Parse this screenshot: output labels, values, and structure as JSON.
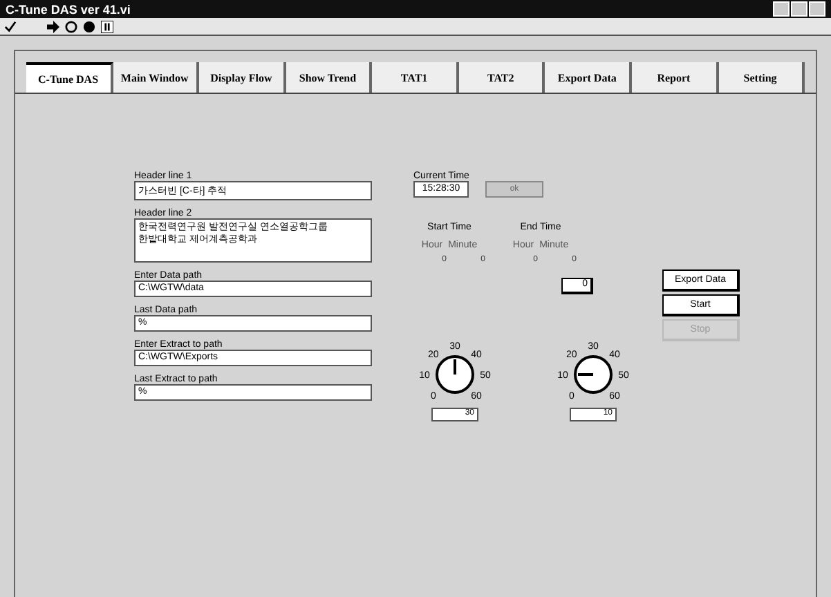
{
  "window": {
    "title": "C-Tune DAS ver 41.vi"
  },
  "tabs": [
    {
      "label": "C-Tune DAS",
      "selected": true
    },
    {
      "label": "Main Window",
      "selected": false
    },
    {
      "label": "Display Flow",
      "selected": false
    },
    {
      "label": "Show Trend",
      "selected": false
    },
    {
      "label": "TAT1",
      "selected": false
    },
    {
      "label": "TAT2",
      "selected": false
    },
    {
      "label": "Export Data",
      "selected": false
    },
    {
      "label": "Report",
      "selected": false
    },
    {
      "label": "Setting",
      "selected": false
    }
  ],
  "fields": [
    {
      "label": "Header line 1",
      "value": "가스터빈 [C-타] 추적",
      "kind": "line"
    },
    {
      "label": "Header line 2",
      "value": "한국전력연구원 발전연구실 연소열공학그룹\n한밭대학교 제어계측공학과",
      "kind": "area"
    },
    {
      "label": "Enter Data path",
      "value": "C:\\WGTW\\data",
      "kind": "line"
    },
    {
      "label": "Last Data path",
      "value": "%",
      "kind": "line"
    },
    {
      "label": "Enter Extract to path",
      "value": "C:\\WGTW\\Exports",
      "kind": "line"
    },
    {
      "label": "Last Extract to path",
      "value": "%",
      "kind": "line"
    }
  ],
  "current_time": {
    "label": "Current Time",
    "value": "15:28:30"
  },
  "ok_indicator": {
    "label": "ok"
  },
  "start_time": {
    "label": "Start Time",
    "hour_label": "Hour",
    "minute_label": "Minute",
    "hour": "0",
    "minute": "0"
  },
  "end_time": {
    "label": "End Time",
    "hour_label": "Hour",
    "minute_label": "Minute",
    "hour": "0",
    "minute": "0"
  },
  "counter": "0",
  "buttons": [
    {
      "label": "Export Data",
      "disabled": false
    },
    {
      "label": "Start",
      "disabled": false
    },
    {
      "label": "Stop",
      "disabled": true
    }
  ],
  "knobs": [
    {
      "scale": [
        "0",
        "10",
        "20",
        "30",
        "40",
        "50",
        "60"
      ],
      "value": "30"
    },
    {
      "scale": [
        "0",
        "10",
        "20",
        "30",
        "40",
        "50",
        "60"
      ],
      "value": "10"
    }
  ]
}
